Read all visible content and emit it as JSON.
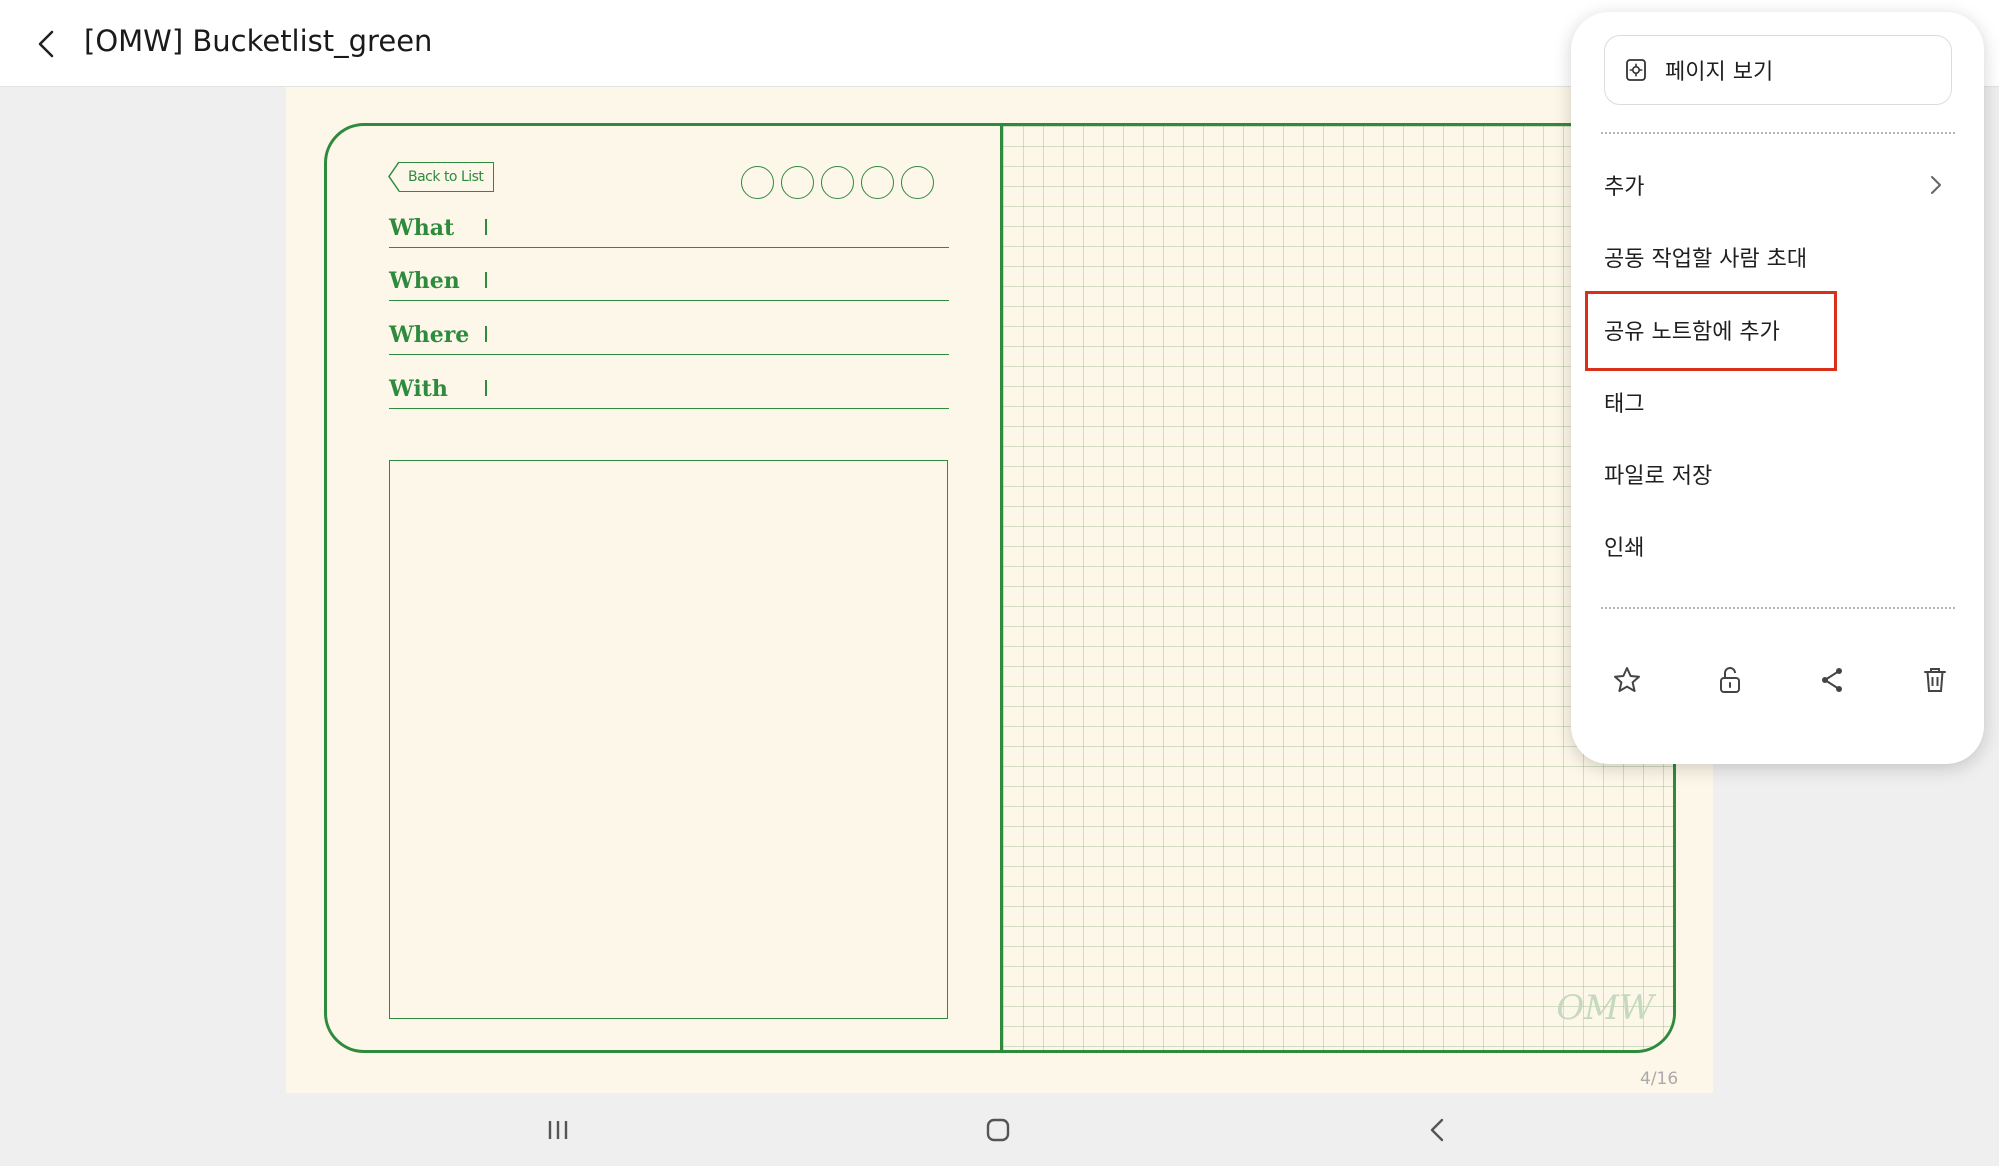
{
  "header": {
    "title": "[OMW] Bucketlist_green",
    "back_icon": "chevron-left-icon"
  },
  "note_page": {
    "back_to_list_label": "Back to List",
    "rating_circles": 5,
    "fields": [
      {
        "label": "What"
      },
      {
        "label": "When"
      },
      {
        "label": "Where"
      },
      {
        "label": "With"
      }
    ],
    "watermark": "OMW",
    "page_counter": "4/16",
    "accent_color": "#2e8b3e",
    "paper_color": "#fdf7e9"
  },
  "menu": {
    "view_page": {
      "label": "페이지 보기",
      "icon": "page-view-icon"
    },
    "items": [
      {
        "label": "추가",
        "has_submenu": true
      },
      {
        "label": "공동 작업할 사람 초대"
      },
      {
        "label": "공유 노트함에 추가",
        "highlighted": true
      },
      {
        "label": "태그"
      },
      {
        "label": "파일로 저장"
      },
      {
        "label": "인쇄"
      }
    ],
    "icon_actions": [
      "star-icon",
      "unlock-icon",
      "share-icon",
      "trash-icon"
    ],
    "highlight_color": "#d9301c"
  },
  "system_nav": {
    "buttons": [
      "recent-apps-icon",
      "home-icon",
      "back-icon"
    ]
  }
}
